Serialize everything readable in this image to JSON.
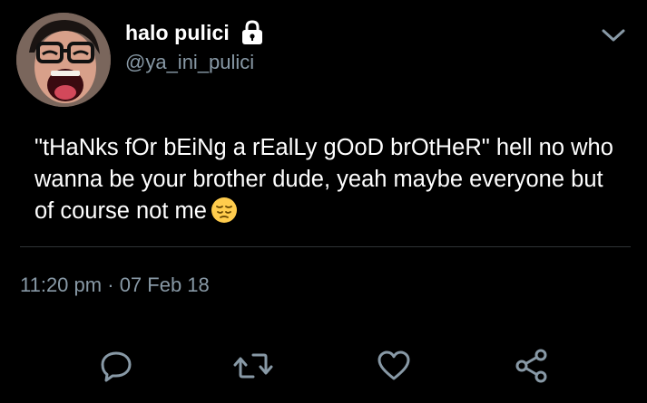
{
  "user": {
    "display_name": "halo pulici",
    "handle": "@ya_ini_pulici"
  },
  "tweet": {
    "text": "\"tHaNks fOr bEiNg a rEalLy gOoD brOtHeR\" hell no who wanna be your brother dude, yeah maybe everyone but of course not me",
    "emoji": "pensive-face-emoji",
    "time": "11:20 pm",
    "separator": "·",
    "date": "07 Feb 18"
  },
  "icons": {
    "lock": "lock-icon",
    "chevron": "chevron-down-icon",
    "reply": "reply-icon",
    "retweet": "retweet-icon",
    "like": "heart-icon",
    "share": "share-icon"
  },
  "colors": {
    "background": "#000000",
    "text_primary": "#ffffff",
    "text_secondary": "#8899a6",
    "divider": "#2f3336",
    "icon": "#8899a6"
  }
}
